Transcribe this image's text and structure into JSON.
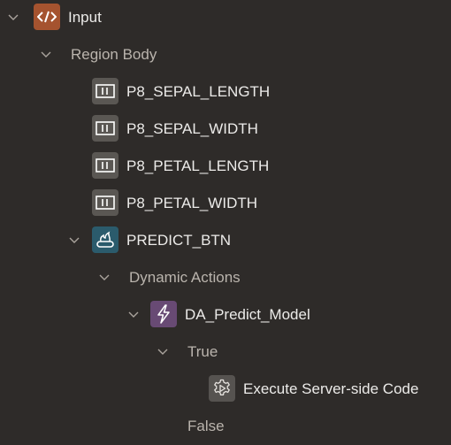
{
  "tree": {
    "nodes": [
      {
        "label": "Input",
        "icon": "code-icon",
        "expanded": true
      },
      {
        "label": "Region Body",
        "icon": null,
        "expanded": true
      },
      {
        "label": "P8_SEPAL_LENGTH",
        "icon": "number-field-icon"
      },
      {
        "label": "P8_SEPAL_WIDTH",
        "icon": "number-field-icon"
      },
      {
        "label": "P8_PETAL_LENGTH",
        "icon": "number-field-icon"
      },
      {
        "label": "P8_PETAL_WIDTH",
        "icon": "number-field-icon"
      },
      {
        "label": "PREDICT_BTN",
        "icon": "button-click-icon",
        "expanded": true
      },
      {
        "label": "Dynamic Actions",
        "icon": null,
        "expanded": true
      },
      {
        "label": "DA_Predict_Model",
        "icon": "lightning-icon",
        "expanded": true
      },
      {
        "label": "True",
        "icon": null,
        "expanded": true
      },
      {
        "label": "Execute Server-side Code",
        "icon": "gear-icon"
      },
      {
        "label": "False",
        "icon": null
      }
    ]
  },
  "colors": {
    "background": "#2e2b29",
    "text_primary": "#ecebe9",
    "text_secondary": "#bab4ad",
    "chevron": "#aaa49d",
    "region_icon_bg": "#a5532f",
    "item_icon_bg": "#5a5753",
    "button_icon_bg": "#2b5b6c",
    "dynamic_action_icon_bg": "#684a74",
    "action_icon_bg": "#565350"
  }
}
